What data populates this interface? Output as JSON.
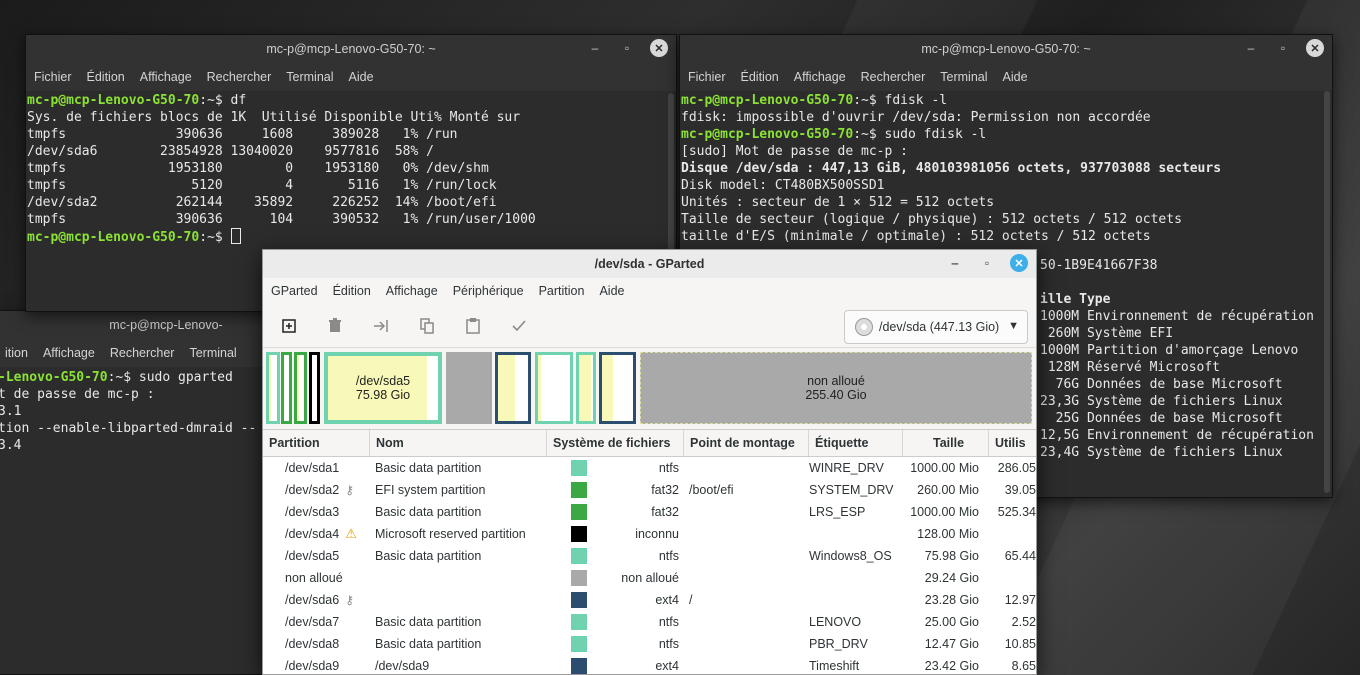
{
  "colors": {
    "prompt": "#8ae234",
    "ntfs": "#70d3b0",
    "fat32": "#3aa844",
    "ext4": "#2b4d6e",
    "unknown": "#000000",
    "unallocated": "#a9a9a9",
    "used": "#f8f8b8",
    "close_active": "#3daee9"
  },
  "term1": {
    "title": "mc-p@mcp-Lenovo-G50-70: ~",
    "menu": [
      "Fichier",
      "Édition",
      "Affichage",
      "Rechercher",
      "Terminal",
      "Aide"
    ],
    "prompt": "mc-p@mcp-Lenovo-G50-70",
    "prompt_suffix": ":~$ ",
    "cmd": "df",
    "lines": [
      "Sys. de fichiers blocs de 1K  Utilisé Disponible Uti% Monté sur",
      "tmpfs              390636     1608     389028   1% /run",
      "/dev/sda6        23854928 13040020    9577816  58% /",
      "tmpfs             1953180        0    1953180   0% /dev/shm",
      "tmpfs                5120        4       5116   1% /run/lock",
      "/dev/sda2          262144    35892     226252  14% /boot/efi",
      "tmpfs              390636      104     390532   1% /run/user/1000"
    ]
  },
  "term2": {
    "title": "mc-p@mcp-Lenovo-G50-70: ~",
    "menu": [
      "Fichier",
      "Édition",
      "Affichage",
      "Rechercher",
      "Terminal",
      "Aide"
    ],
    "prompt": "mc-p@mcp-Lenovo-G50-70",
    "prompt_suffix": ":~$ ",
    "cmd1": "fdisk -l",
    "line1": "fdisk: impossible d'ouvrir /dev/sda: Permission non accordée",
    "cmd2": "sudo fdisk -l",
    "line2": "[sudo] Mot de passe de mc-p :",
    "disk_line": "Disque /dev/sda : 447,13 GiB, 480103981056 octets, 937703088 secteurs",
    "lines": [
      "Disk model: CT480BX500SSD1",
      "Unités : secteur de 1 × 512 = 512 octets",
      "Taille de secteur (logique / physique) : 512 octets / 512 octets",
      "taille d'E/S (minimale / optimale) : 512 octets / 512 octets"
    ],
    "visible_lines": [
      "50-1B9E41667F38",
      "",
      "ille Type",
      "1000M Environnement de récupération",
      " 260M Système EFI",
      "1000M Partition d'amorçage Lenovo",
      " 128M Réservé Microsoft",
      "  76G Données de base Microsoft",
      "23,3G Système de fichiers Linux",
      "  25G Données de base Microsoft",
      "12,5G Environnement de récupération",
      "23,4G Système de fichiers Linux"
    ],
    "visible_header": "ille Type"
  },
  "term3": {
    "title": "mc-p@mcp-Lenovo-",
    "menu": [
      "ition",
      "Affichage",
      "Rechercher",
      "Terminal"
    ],
    "prompt": "-Lenovo-G50-70",
    "prompt_suffix": ":~$ ",
    "cmd": "sudo gparted",
    "lines": [
      "t de passe de mc-p :",
      "3.1",
      "tion --enable-libparted-dmraid --",
      "3.4"
    ]
  },
  "gparted": {
    "title": "/dev/sda - GParted",
    "menu": [
      "GParted",
      "Édition",
      "Affichage",
      "Périphérique",
      "Partition",
      "Aide"
    ],
    "device": "/dev/sda (447.13 Gio)",
    "selected_partition": {
      "name": "/dev/sda5",
      "size": "75.98 Gio"
    },
    "unallocated_block": {
      "name": "non alloué",
      "size": "255.40 Gio"
    },
    "columns": [
      "Partition",
      "Nom",
      "Système de fichiers",
      "Point de montage",
      "Étiquette",
      "Taille",
      "Utilis"
    ],
    "rows": [
      {
        "partition": "/dev/sda1",
        "name": "Basic data partition",
        "fs": "ntfs",
        "color": "#70d3b0",
        "mount": "",
        "label": "WINRE_DRV",
        "size": "1000.00 Mio",
        "used": "286.05",
        "icon": ""
      },
      {
        "partition": "/dev/sda2",
        "name": "EFI system partition",
        "fs": "fat32",
        "color": "#3aa844",
        "mount": "/boot/efi",
        "label": "SYSTEM_DRV",
        "size": "260.00 Mio",
        "used": "39.05",
        "icon": "key"
      },
      {
        "partition": "/dev/sda3",
        "name": "Basic data partition",
        "fs": "fat32",
        "color": "#3aa844",
        "mount": "",
        "label": "LRS_ESP",
        "size": "1000.00 Mio",
        "used": "525.34",
        "icon": ""
      },
      {
        "partition": "/dev/sda4",
        "name": "Microsoft reserved partition",
        "fs": "inconnu",
        "color": "#000000",
        "mount": "",
        "label": "",
        "size": "128.00 Mio",
        "used": "",
        "icon": "warn"
      },
      {
        "partition": "/dev/sda5",
        "name": "Basic data partition",
        "fs": "ntfs",
        "color": "#70d3b0",
        "mount": "",
        "label": "Windows8_OS",
        "size": "75.98 Gio",
        "used": "65.44",
        "icon": ""
      },
      {
        "partition": "non alloué",
        "name": "",
        "fs": "non alloué",
        "color": "#a9a9a9",
        "mount": "",
        "label": "",
        "size": "29.24 Gio",
        "used": "",
        "icon": ""
      },
      {
        "partition": "/dev/sda6",
        "name": "",
        "fs": "ext4",
        "color": "#2b4d6e",
        "mount": "/",
        "label": "",
        "size": "23.28 Gio",
        "used": "12.97",
        "icon": "key"
      },
      {
        "partition": "/dev/sda7",
        "name": "Basic data partition",
        "fs": "ntfs",
        "color": "#70d3b0",
        "mount": "",
        "label": "LENOVO",
        "size": "25.00 Gio",
        "used": "2.52",
        "icon": ""
      },
      {
        "partition": "/dev/sda8",
        "name": "Basic data partition",
        "fs": "ntfs",
        "color": "#70d3b0",
        "mount": "",
        "label": "PBR_DRV",
        "size": "12.47 Gio",
        "used": "10.85",
        "icon": ""
      },
      {
        "partition": "/dev/sda9",
        "name": "/dev/sda9",
        "fs": "ext4",
        "color": "#2b4d6e",
        "mount": "",
        "label": "Timeshift",
        "size": "23.42 Gio",
        "used": "8.65",
        "icon": ""
      }
    ]
  }
}
